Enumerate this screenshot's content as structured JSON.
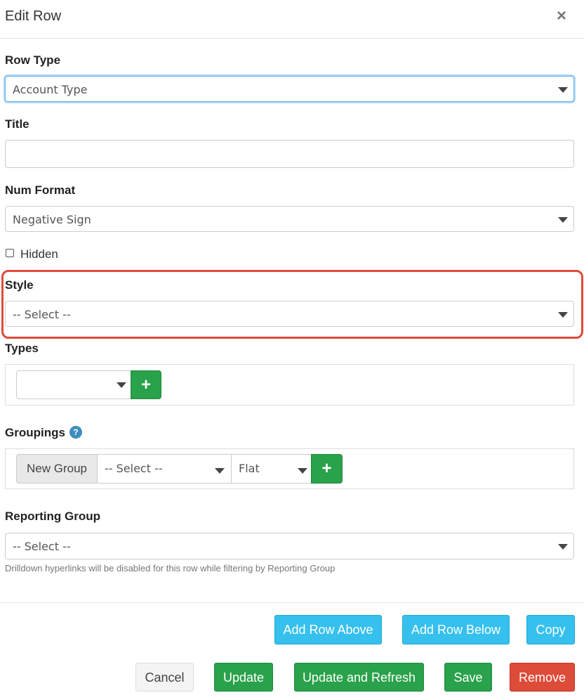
{
  "modal": {
    "title": "Edit Row",
    "close_icon": "×"
  },
  "row_type": {
    "label": "Row Type",
    "value": "Account Type"
  },
  "title_field": {
    "label": "Title",
    "value": ""
  },
  "num_format": {
    "label": "Num Format",
    "value": "Negative Sign"
  },
  "hidden": {
    "label": "Hidden",
    "checked": false
  },
  "style": {
    "label": "Style",
    "value": "-- Select --"
  },
  "types": {
    "label": "Types",
    "value": "",
    "add_icon": "+"
  },
  "groupings": {
    "label": "Groupings",
    "help_icon": "?",
    "addon": "New Group",
    "group_select": "-- Select --",
    "mode_select": "Flat",
    "add_icon": "+"
  },
  "reporting_group": {
    "label": "Reporting Group",
    "value": "-- Select --",
    "hint": "Drilldown hyperlinks will be disabled for this row while filtering by Reporting Group"
  },
  "buttons": {
    "add_row_above": "Add Row Above",
    "add_row_below": "Add Row Below",
    "copy": "Copy",
    "cancel": "Cancel",
    "update": "Update",
    "update_and_refresh": "Update and Refresh",
    "save": "Save",
    "remove": "Remove"
  },
  "colors": {
    "primary_green": "#2aa14b",
    "cyan": "#35c0ee",
    "danger": "#dd4b39",
    "highlight": "#e04a3b",
    "focus": "#66afe9"
  }
}
